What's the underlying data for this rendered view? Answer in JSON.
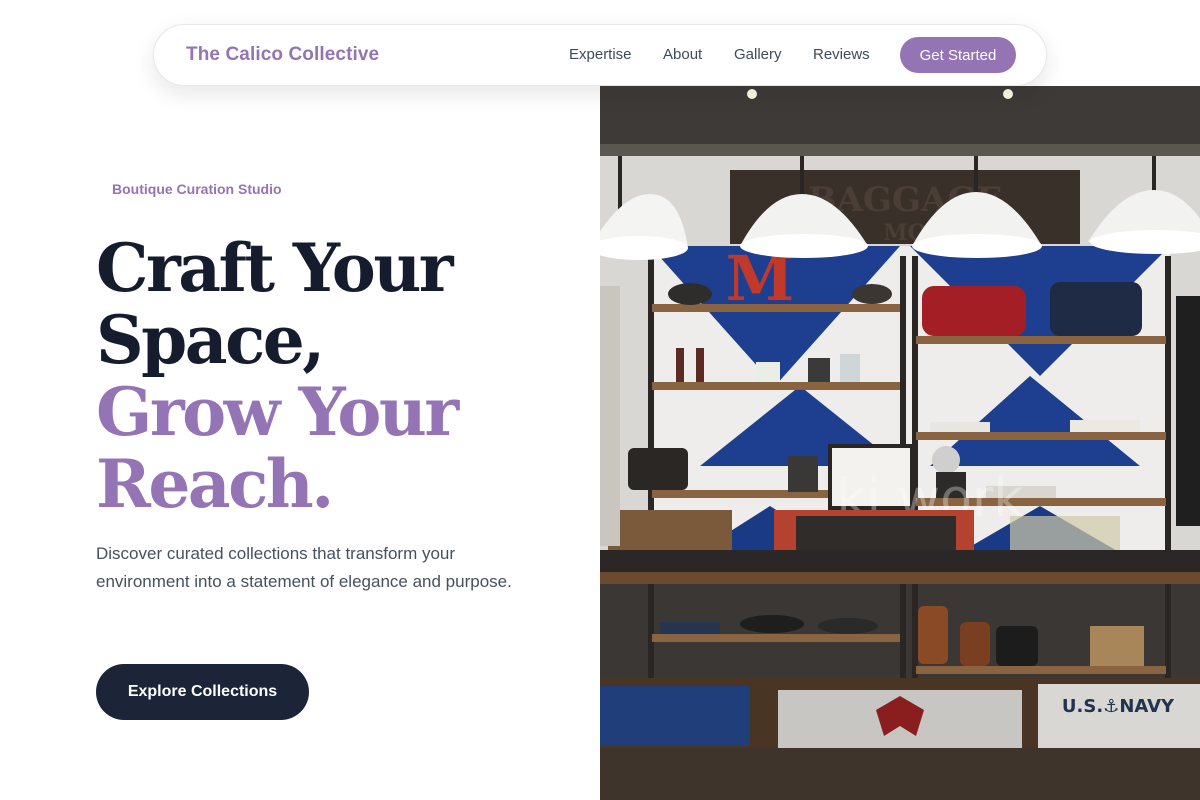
{
  "nav": {
    "brand": "The Calico Collective",
    "links": [
      "Expertise",
      "About",
      "Gallery",
      "Reviews"
    ],
    "cta_label": "Get Started"
  },
  "hero": {
    "eyebrow": "Boutique Curation Studio",
    "headline_lines": [
      "Craft Your",
      "Space,"
    ],
    "headline_accent_lines": [
      "Grow Your",
      "Reach."
    ],
    "description": "Discover curated collections that transform your environment into a statement of elegance and purpose.",
    "cta_label": "Explore Collections"
  },
  "image": {
    "sign_text": "BAGGAGE",
    "sign_text_2": "MO",
    "letter_sign": "M",
    "neon_text": "ki   work",
    "folded_shirt_text": "U.S.⚓NAVY"
  },
  "colors": {
    "accent": "#9474b4",
    "dark": "#141c2e",
    "button_dark": "#1c2538"
  }
}
